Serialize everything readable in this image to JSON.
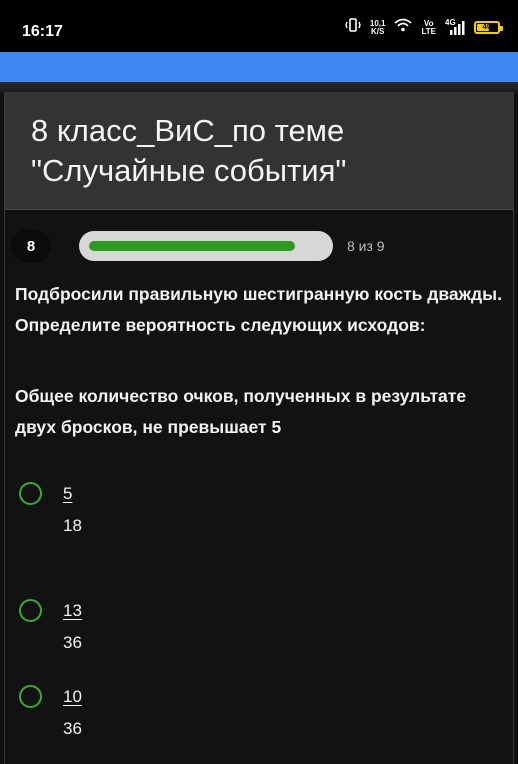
{
  "status_bar": {
    "time": "16:17",
    "network_speed_value": "10,1",
    "network_speed_unit": "K/S",
    "volte_top": "Vo",
    "volte_bottom": "LTE",
    "network_type": "4G",
    "battery_level": "40"
  },
  "header": {
    "title": "8 класс_ВиС_по теме \"Случайные события\""
  },
  "progress": {
    "question_number": "8",
    "label": "8 из 9",
    "fraction": 0.88
  },
  "question": {
    "text": "Подбросили правильную шестигранную кость дважды. Определите вероятность следующих исходов:",
    "subtext": "Общее количество очков, полученных в результате двух бросков, не превышает 5"
  },
  "options": [
    {
      "numerator": "5",
      "denominator": "18"
    },
    {
      "numerator": "13",
      "denominator": "36"
    },
    {
      "numerator": "10",
      "denominator": "36"
    }
  ],
  "colors": {
    "accent_blue": "#3f86f0",
    "radio_green": "#3cab33",
    "progress_green": "#2c9a1e"
  }
}
